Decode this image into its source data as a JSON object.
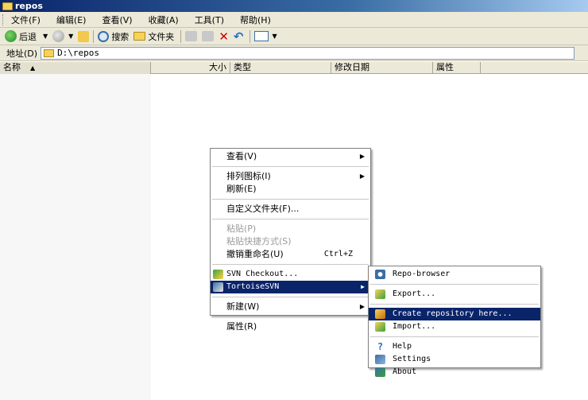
{
  "window": {
    "title": "repos"
  },
  "menubar": [
    "文件(F)",
    "编辑(E)",
    "查看(V)",
    "收藏(A)",
    "工具(T)",
    "帮助(H)"
  ],
  "toolbar": {
    "back_label": "后退",
    "search_label": "搜索",
    "folders_label": "文件夹"
  },
  "address": {
    "label": "地址(D)",
    "value": "D:\\repos"
  },
  "columns": {
    "name": "名称",
    "size": "大小",
    "type": "类型",
    "modified": "修改日期",
    "attributes": "属性"
  },
  "context_menu": {
    "view": "查看(V)",
    "arrange": "排列图标(I)",
    "refresh": "刷新(E)",
    "customize": "自定义文件夹(F)...",
    "paste": "粘贴(P)",
    "paste_shortcut": "粘贴快捷方式(S)",
    "undo_rename": "撤销重命名(U)",
    "undo_shortcut": "Ctrl+Z",
    "svn_checkout": "SVN Checkout...",
    "tortoisesvn": "TortoiseSVN",
    "new": "新建(W)",
    "properties": "属性(R)"
  },
  "submenu": {
    "repo_browser": "Repo-browser",
    "export": "Export...",
    "create_repo": "Create repository here...",
    "import": "Import...",
    "help": "Help",
    "settings": "Settings",
    "about": "About"
  }
}
